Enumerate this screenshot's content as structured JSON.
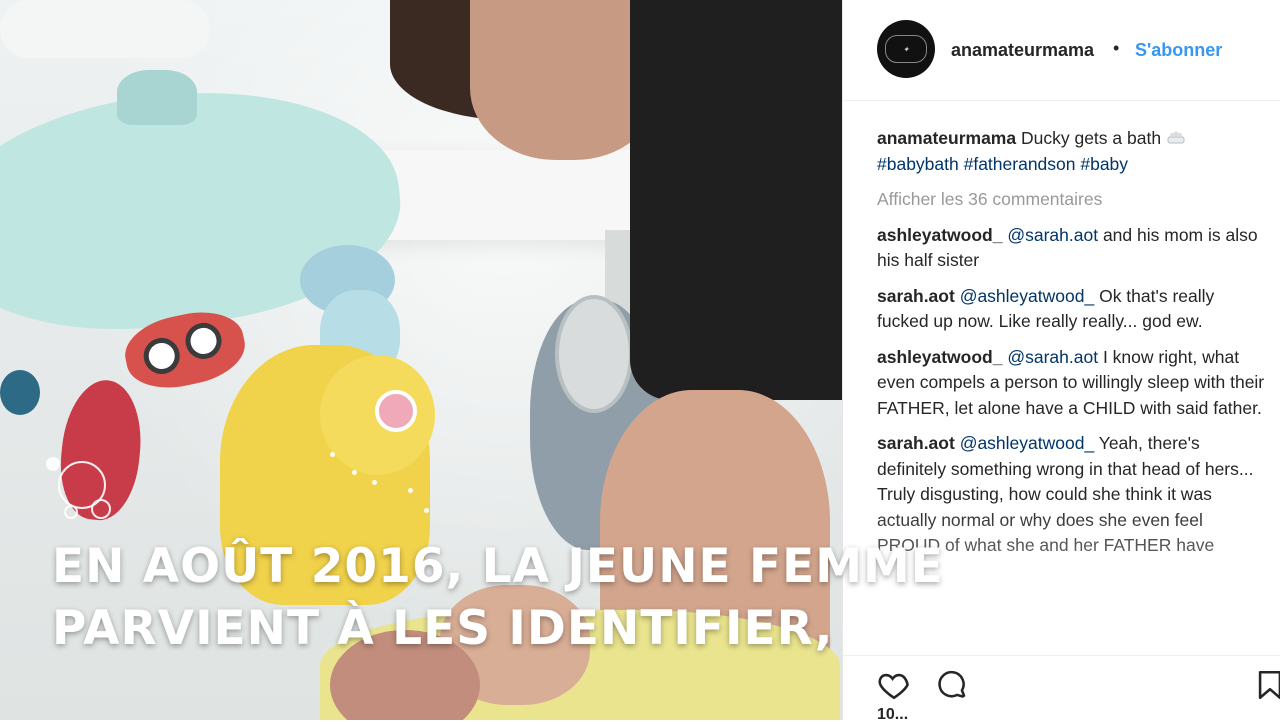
{
  "caption": {
    "line1": "EN AOÛT 2016, LA JEUNE FEMME",
    "line2": "PARVIENT À LES IDENTIFIER,"
  },
  "post": {
    "username": "anamateurmama",
    "separator": "•",
    "follow_label": "S'abonner",
    "description_text": "Ducky gets a bath",
    "description_icon": "bathtub-icon",
    "hashtags": "#babybath #fatherandson #baby",
    "view_comments_label": "Afficher les 36 commentaires",
    "likes_partial": "10..."
  },
  "comments": [
    {
      "user": "ashleyatwood_",
      "mention": "@sarah.aot",
      "text": "and his mom is also his half sister"
    },
    {
      "user": "sarah.aot",
      "mention": "@ashleyatwood_",
      "text": "Ok that's really fucked up now. Like really really... god ew."
    },
    {
      "user": "ashleyatwood_",
      "mention": "@sarah.aot",
      "text": "I know right, what even compels a person to willingly sleep with their FATHER, let alone have a CHILD with said father."
    },
    {
      "user": "sarah.aot",
      "mention": "@ashleyatwood_",
      "text": "Yeah, there's definitely something wrong in that head of hers... Truly disgusting, how could she think it was actually normal or why does she even feel PROUD of what she and her FATHER have done? I have trouble understanding... I must say"
    }
  ],
  "icons": {
    "like": "heart-icon",
    "comment": "comment-bubble-icon",
    "save": "bookmark-icon"
  },
  "colors": {
    "link_blue": "#3897f0",
    "hashtag": "#003569",
    "muted": "#999999"
  }
}
